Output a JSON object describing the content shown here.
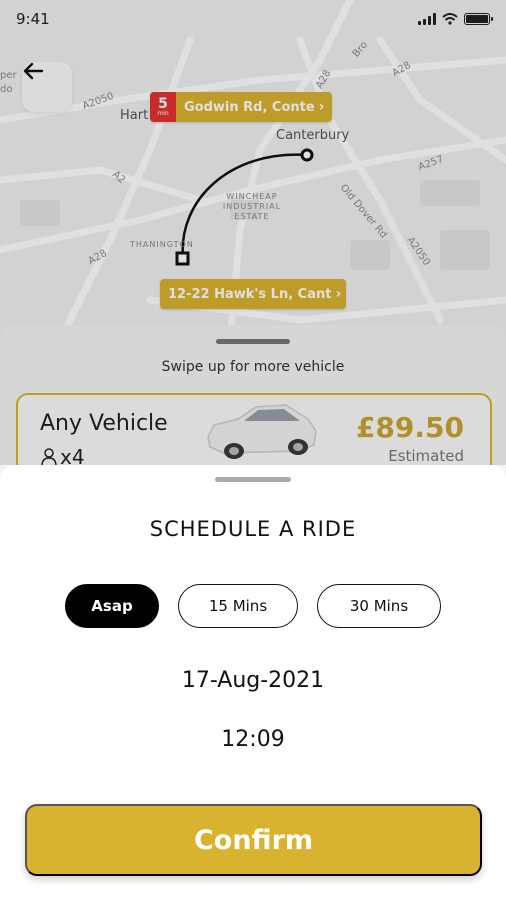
{
  "status_bar": {
    "time": "9:41"
  },
  "map": {
    "labels": {
      "canterbury": "Canterbury",
      "harbledown": "Hart",
      "wincheap": "WINCHEAP INDUSTRIAL ESTATE",
      "thanington": "THANINGTON",
      "old_dover_rd": "Old Dover Rd",
      "road_a2050_top": "A2050",
      "road_a2050_right": "A2050",
      "road_a2": "A2",
      "road_a28_left": "A28",
      "road_a28_top": "A28",
      "road_a257": "A257",
      "road_a28_mid": "A28",
      "road_bro": "Bro",
      "edge_per": "per",
      "edge_do": "do"
    },
    "destination_label": "Godwin Rd, Conte",
    "eta_value": "5",
    "eta_unit": "min",
    "origin_label": "12-22 Hawk's Ln, Cant"
  },
  "vehicle_panel": {
    "swipe_hint": "Swipe up for more vehicle",
    "vehicle": {
      "name": "Any Vehicle",
      "capacity": "x4",
      "price": "£89.50",
      "price_note": "Estimated"
    }
  },
  "sheet": {
    "title": "SCHEDULE A RIDE",
    "chips": [
      {
        "label": "Asap",
        "active": true
      },
      {
        "label": "15 Mins",
        "active": false
      },
      {
        "label": "30 Mins",
        "active": false
      }
    ],
    "date": "17-Aug-2021",
    "time": "12:09",
    "confirm_label": "Confirm"
  },
  "colors": {
    "accent": "#d9b22f",
    "eta_badge": "#e53131",
    "active_chip": "#000000",
    "price": "#c9a431"
  },
  "icons": {
    "back": "arrow-left-icon",
    "passenger": "person-icon",
    "chevron": "chevron-right-icon",
    "signal": "signal-icon",
    "wifi": "wifi-icon",
    "battery": "battery-icon"
  }
}
